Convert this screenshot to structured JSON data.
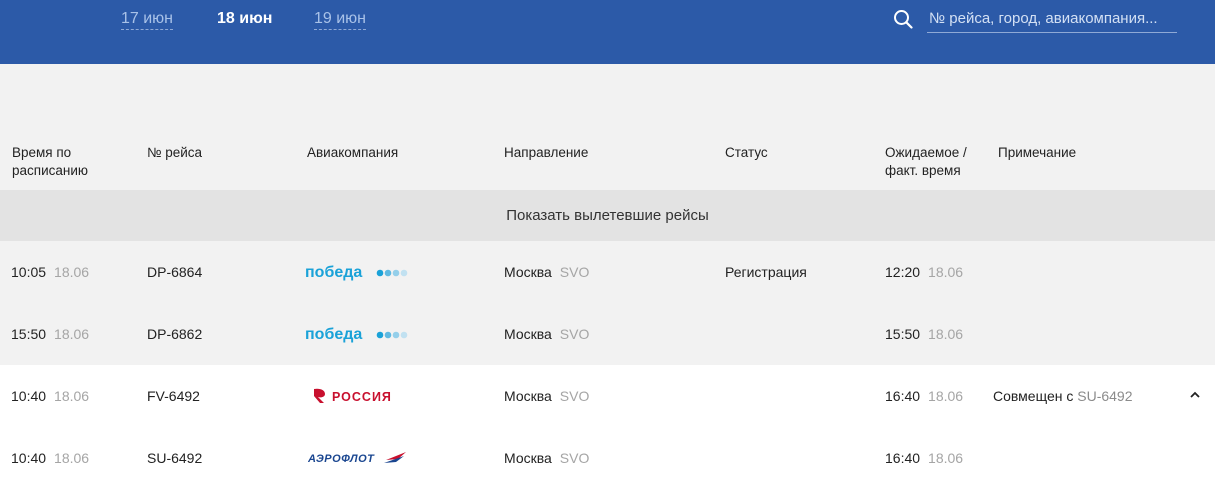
{
  "dates": [
    {
      "label": "17 июн",
      "active": false
    },
    {
      "label": "18 июн",
      "active": true
    },
    {
      "label": "19 июн",
      "active": false
    }
  ],
  "search": {
    "placeholder": "№ рейса, город, авиакомпания..."
  },
  "columns": {
    "scheduled_time": "Время по расписанию",
    "flight_number": "№ рейса",
    "airline": "Авиакомпания",
    "direction": "Направление",
    "status": "Статус",
    "expected_time": "Ожидаемое / факт. время",
    "note": "Примечание"
  },
  "show_departed_label": "Показать вылетевшие рейсы",
  "flights": [
    {
      "time": "10:05",
      "date": "18.06",
      "flight": "DP-6864",
      "airline_logo": "победа",
      "city": "Москва",
      "airport": "SVO",
      "status": "Регистрация",
      "exp_time": "12:20",
      "exp_date": "18.06",
      "note_prefix": "",
      "note_code": ""
    },
    {
      "time": "15:50",
      "date": "18.06",
      "flight": "DP-6862",
      "airline_logo": "победа",
      "city": "Москва",
      "airport": "SVO",
      "status": "",
      "exp_time": "15:50",
      "exp_date": "18.06",
      "note_prefix": "",
      "note_code": ""
    },
    {
      "time": "10:40",
      "date": "18.06",
      "flight": "FV-6492",
      "airline_logo": "РОССИЯ",
      "city": "Москва",
      "airport": "SVO",
      "status": "",
      "exp_time": "16:40",
      "exp_date": "18.06",
      "note_prefix": "Совмещен с ",
      "note_code": "SU-6492"
    },
    {
      "time": "10:40",
      "date": "18.06",
      "flight": "SU-6492",
      "airline_logo": "АЭРОФЛОТ",
      "city": "Москва",
      "airport": "SVO",
      "status": "",
      "exp_time": "16:40",
      "exp_date": "18.06",
      "note_prefix": "",
      "note_code": ""
    }
  ],
  "colors": {
    "header_blue": "#2c5aa8",
    "pobeda_blue": "#1aa2d8",
    "rossiya_red": "#c8102e",
    "aeroflot_blue": "#1a4690"
  },
  "icons": {
    "search": "search-icon",
    "collapse": "chevron-up-icon"
  }
}
